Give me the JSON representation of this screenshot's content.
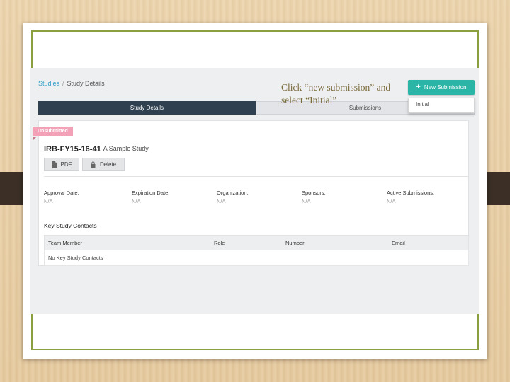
{
  "annotation": "Click “new submission” and select “Initial”",
  "breadcrumb": {
    "root": "Studies",
    "separator": "/",
    "current": "Study Details"
  },
  "new_submission_button": {
    "label": "New Submission",
    "icon": "plus-icon"
  },
  "dropdown": {
    "items": [
      "Initial"
    ]
  },
  "tabs": [
    {
      "label": "Study Details",
      "active": true
    },
    {
      "label": "Submissions",
      "active": false
    }
  ],
  "study": {
    "status_badge": "Unsubmitted",
    "id": "IRB-FY15-16-41",
    "name": "A Sample Study",
    "actions": {
      "pdf": "PDF",
      "delete": "Delete"
    }
  },
  "fields": [
    {
      "label": "Approval Date:",
      "value": "N/A"
    },
    {
      "label": "Expiration Date:",
      "value": "N/A"
    },
    {
      "label": "Organization:",
      "value": "N/A"
    },
    {
      "label": "Sponsors:",
      "value": "N/A"
    },
    {
      "label": "Active Submissions:",
      "value": "N/A"
    }
  ],
  "contacts": {
    "title": "Key Study Contacts",
    "columns": [
      "Team Member",
      "Role",
      "Number",
      "Email"
    ],
    "empty_text": "No Key Study Contacts"
  },
  "colors": {
    "accent": "#2bb5a7",
    "nav_dark": "#2f4050",
    "badge": "#f2a1b6",
    "frame": "#8a9f3e",
    "link": "#2e9fc4"
  }
}
